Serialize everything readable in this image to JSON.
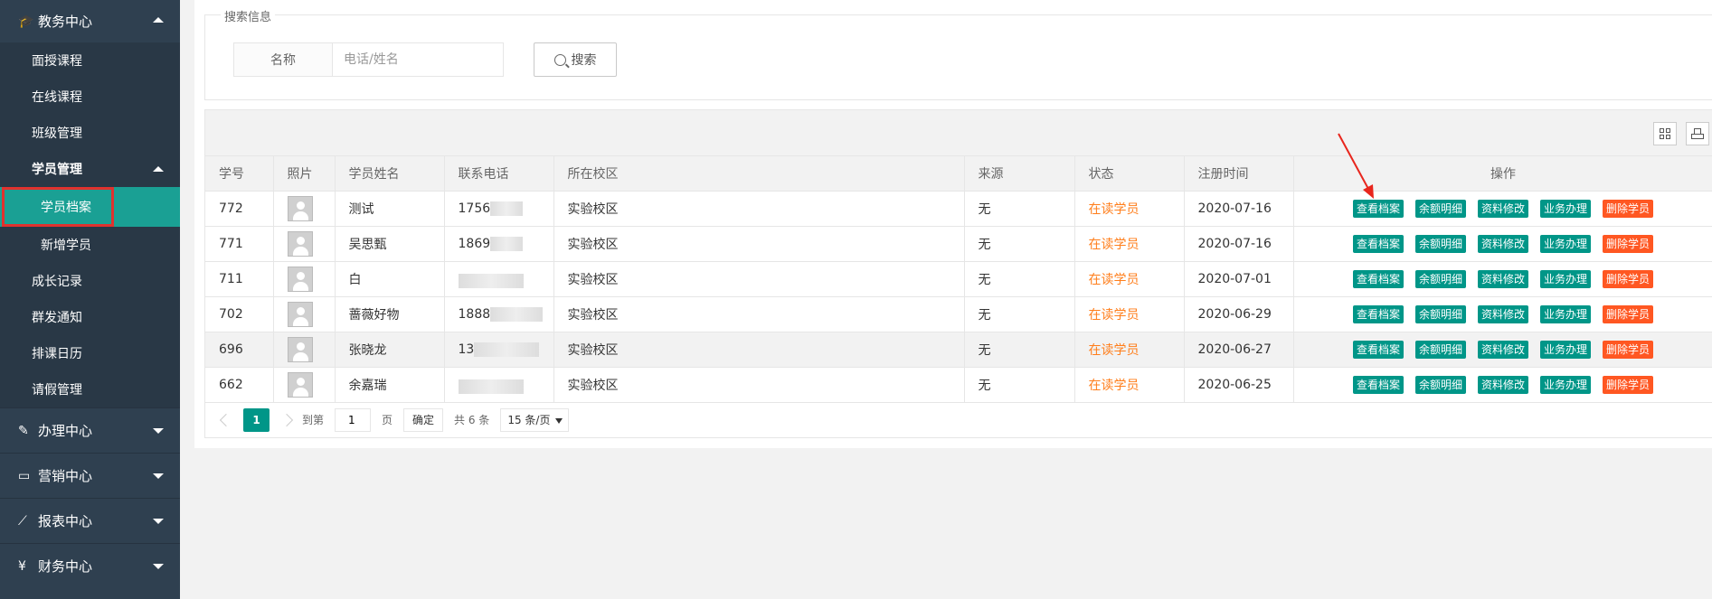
{
  "sidebar": {
    "header": {
      "label": "教务中心",
      "icon": "graduation-cap-icon"
    },
    "items": [
      {
        "label": "面授课程"
      },
      {
        "label": "在线课程"
      },
      {
        "label": "班级管理"
      }
    ],
    "student_mgmt": {
      "label": "学员管理"
    },
    "student_sub": [
      {
        "label": "学员档案",
        "active": true
      },
      {
        "label": "新增学员"
      }
    ],
    "more_items": [
      {
        "label": "成长记录"
      },
      {
        "label": "群发通知"
      },
      {
        "label": "排课日历"
      },
      {
        "label": "请假管理"
      }
    ],
    "categories": [
      {
        "label": "办理中心",
        "icon": "edit-icon"
      },
      {
        "label": "营销中心",
        "icon": "laptop-icon"
      },
      {
        "label": "报表中心",
        "icon": "line-chart-icon"
      },
      {
        "label": "财务中心",
        "icon": "yen-icon"
      }
    ]
  },
  "search": {
    "legend": "搜索信息",
    "label": "名称",
    "placeholder": "电话/姓名",
    "button": "搜索"
  },
  "table": {
    "columns": [
      "学号",
      "照片",
      "学员姓名",
      "联系电话",
      "所在校区",
      "来源",
      "状态",
      "注册时间",
      "操作"
    ],
    "rows": [
      {
        "id": "772",
        "name": "测试",
        "phone": "1756",
        "campus": "实验校区",
        "source": "无",
        "status": "在读学员",
        "date": "2020-07-16"
      },
      {
        "id": "771",
        "name": "吴思甄",
        "phone": "1869",
        "campus": "实验校区",
        "source": "无",
        "status": "在读学员",
        "date": "2020-07-16"
      },
      {
        "id": "711",
        "name": "白",
        "phone": "",
        "campus": "实验校区",
        "source": "无",
        "status": "在读学员",
        "date": "2020-07-01"
      },
      {
        "id": "702",
        "name": "蔷薇好物",
        "phone": "1888",
        "campus": "实验校区",
        "source": "无",
        "status": "在读学员",
        "date": "2020-06-29"
      },
      {
        "id": "696",
        "name": "张晓龙",
        "phone": "13",
        "campus": "实验校区",
        "source": "无",
        "status": "在读学员",
        "date": "2020-06-27"
      },
      {
        "id": "662",
        "name": "余嘉瑞",
        "phone": "",
        "campus": "实验校区",
        "source": "无",
        "status": "在读学员",
        "date": "2020-06-25"
      }
    ],
    "actions": [
      "查看档案",
      "余额明细",
      "资料修改",
      "业务办理",
      "删除学员"
    ]
  },
  "pager": {
    "current": "1",
    "goto_label": "到第",
    "goto_value": "1",
    "page_label": "页",
    "confirm": "确定",
    "total": "共 6 条",
    "per_page": "15 条/页"
  },
  "colors": {
    "accent": "#009688",
    "danger": "#ff5722",
    "status": "#ff7e1b",
    "sidebar": "#2f4050",
    "highlight": "#e0322e"
  }
}
